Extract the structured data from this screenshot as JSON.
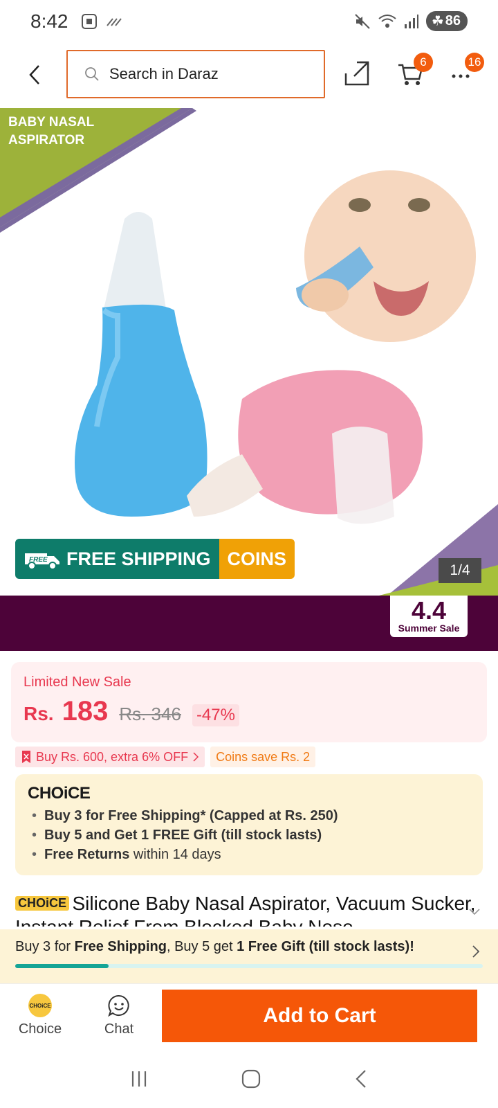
{
  "status_bar": {
    "time": "8:42",
    "battery": "86"
  },
  "header": {
    "search_placeholder": "Search in Daraz",
    "cart_count": "6",
    "more_count": "16"
  },
  "product_image": {
    "corner_label_line1": "BABY NASAL",
    "corner_label_line2": "ASPIRATOR",
    "free_badge": "FREE",
    "free_shipping_label": "FREE SHIPPING",
    "coins_label": "COINS",
    "page_indicator": "1/4"
  },
  "promo": {
    "sale_number": "4.4",
    "sale_label": "Summer Sale"
  },
  "price": {
    "sale_tag": "Limited New Sale",
    "currency": "Rs.",
    "current": "183",
    "original": "Rs. 346",
    "discount": "-47%"
  },
  "vouchers": {
    "voucher_1": "Buy Rs. 600, extra 6% OFF",
    "voucher_2": "Coins save Rs. 2"
  },
  "choice": {
    "logo": "CHOiCE",
    "items": [
      {
        "bold": "Buy 3 for  Free Shipping* (Capped at Rs. 250)",
        "rest": ""
      },
      {
        "bold": "Buy 5 and Get 1 FREE Gift (till stock lasts)",
        "rest": ""
      },
      {
        "bold": "Free Returns",
        "rest": " within 14 days"
      }
    ]
  },
  "product": {
    "badge": "CHOiCE",
    "title": "Silicone Baby Nasal Aspirator, Vacuum Sucker, Instant Relief From Blocked Baby Nose"
  },
  "bundle": {
    "part1": "Buy 3 for ",
    "part2": "Free Shipping",
    "part3": ", Buy 5 get ",
    "part4": "1 Free Gift (till stock lasts)!",
    "progress": 0.2
  },
  "bottom_bar": {
    "choice_icon_text": "CHOiCE",
    "choice_label": "Choice",
    "chat_label": "Chat",
    "add_to_cart_label": "Add to Cart"
  },
  "colors": {
    "accent": "#f55708",
    "sale_red": "#e8384f",
    "promo_purple": "#4d0339",
    "choice_yellow": "#f7c73e",
    "shipping_green": "#0e7c6a",
    "coins_orange": "#f0a106"
  }
}
